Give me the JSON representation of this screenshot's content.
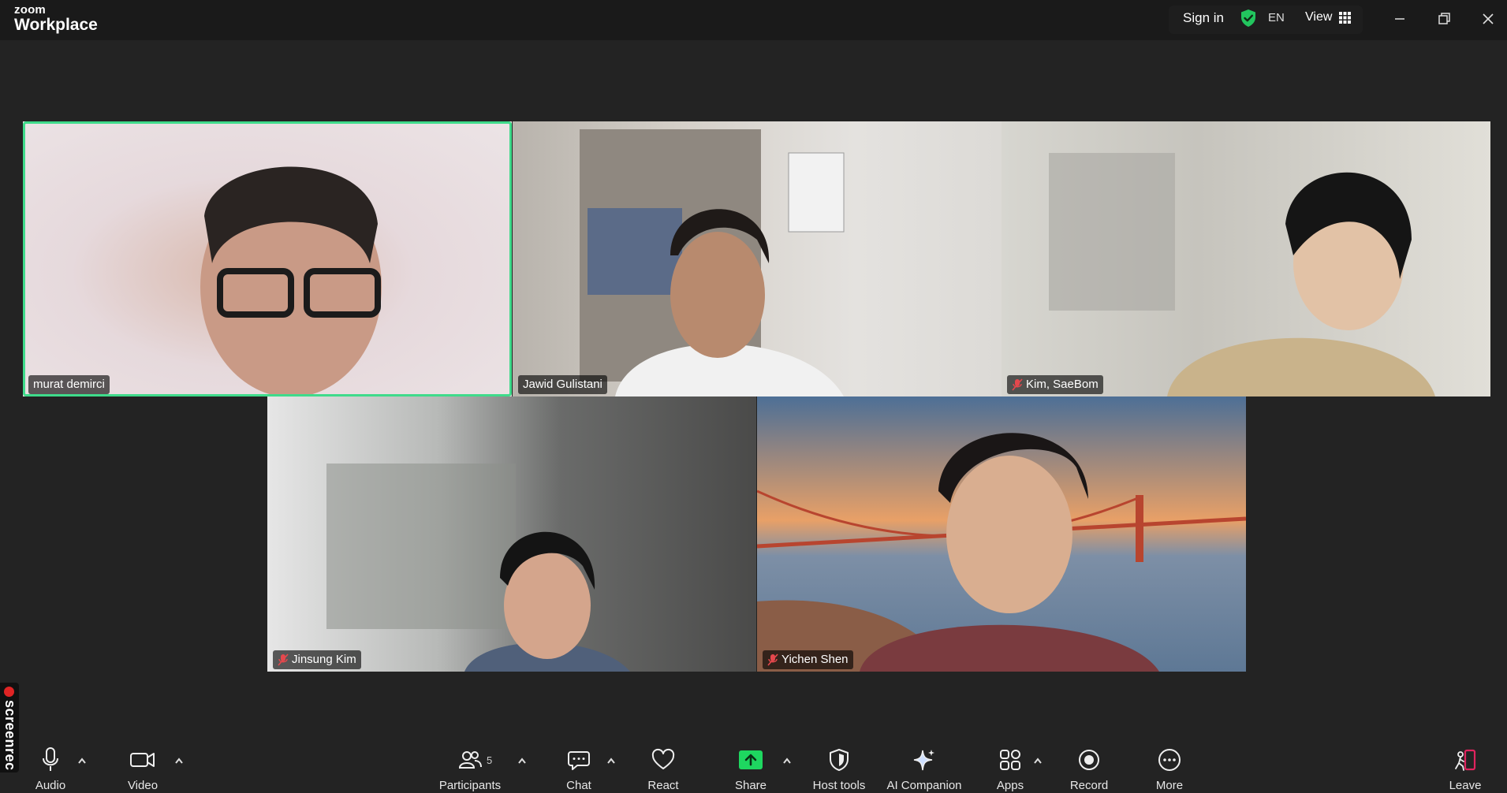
{
  "app": {
    "brand_small": "zoom",
    "brand_big": "Workplace"
  },
  "titlebar": {
    "sign_in": "Sign in",
    "language": "EN",
    "view_label": "View"
  },
  "participants": [
    {
      "name": "murat demirci",
      "muted": false,
      "active_speaker": true,
      "bg": "#e9dfe2"
    },
    {
      "name": "Jawid Gulistani",
      "muted": false,
      "active_speaker": false,
      "bg": "#dcd9d4"
    },
    {
      "name": "Kim, SaeBom",
      "muted": true,
      "active_speaker": false,
      "bg": "#cfccc5"
    },
    {
      "name": "Jinsung Kim",
      "muted": true,
      "active_speaker": false,
      "bg": "#bdbdbb"
    },
    {
      "name": "Yichen Shen",
      "muted": true,
      "active_speaker": false,
      "bg": "#8a7f79"
    }
  ],
  "recorder": {
    "label": "screenrec"
  },
  "toolbar": {
    "audio": "Audio",
    "video": "Video",
    "participants": "Participants",
    "participants_count": "5",
    "chat": "Chat",
    "react": "React",
    "share": "Share",
    "host_tools": "Host tools",
    "ai_companion": "AI Companion",
    "apps": "Apps",
    "record": "Record",
    "more": "More",
    "leave": "Leave"
  },
  "colors": {
    "active_speaker_border": "#3fdb8b",
    "share_green": "#1ed760",
    "shield_green": "#22c55e",
    "leave_red": "#e0245e"
  }
}
